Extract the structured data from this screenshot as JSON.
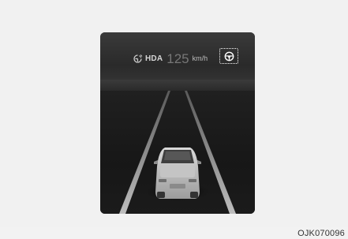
{
  "hud": {
    "indicator_label": "HDA",
    "set_speed": "125",
    "speed_unit": "km/h",
    "assist_icon": "steering-wheel-icon",
    "indicator_icon": "highway-driving-assist-icon"
  },
  "caption": "OJK070096",
  "colors": {
    "screen_background": "#1e1e1e",
    "lane_lines": "#bdbdbd",
    "highlight_border": "#ffffff"
  }
}
